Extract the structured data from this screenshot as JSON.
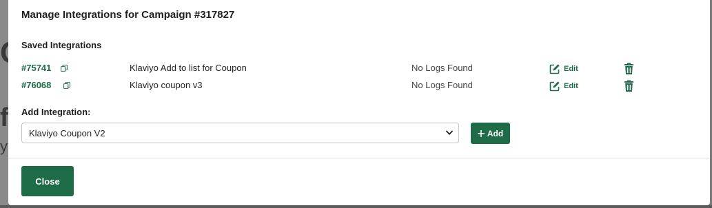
{
  "modal": {
    "title": "Manage Integrations for Campaign #317827",
    "saved_label": "Saved Integrations",
    "add_label": "Add Integration:",
    "close_label": "Close"
  },
  "integrations": [
    {
      "id": "#75741",
      "name": "Klaviyo Add to list for Coupon",
      "logs": "No Logs Found",
      "edit_label": "Edit"
    },
    {
      "id": "#76068",
      "name": "Klaviyo coupon v3",
      "logs": "No Logs Found",
      "edit_label": "Edit"
    }
  ],
  "add_integration": {
    "selected": "Klaviyo Coupon V2",
    "button_label": "Add"
  },
  "icons": {
    "copy": "copy-icon",
    "edit": "edit-icon",
    "delete": "trash-icon",
    "chevron": "chevron-down-icon",
    "plus": "plus-icon"
  },
  "colors": {
    "accent": "#1e6b47",
    "backdrop": "#6b6b6b"
  }
}
